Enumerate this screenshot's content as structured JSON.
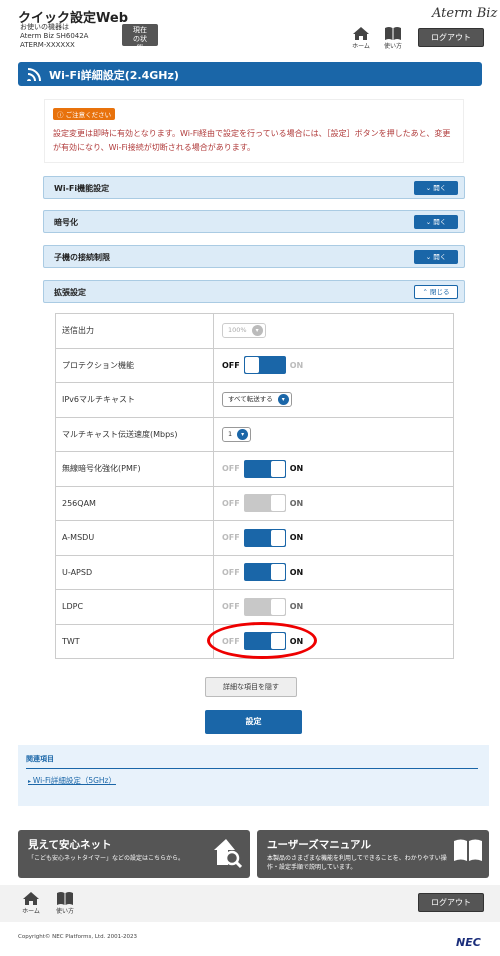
{
  "header": {
    "app_title": "クイック設定Web",
    "device_lines": [
      "お使いの機器は",
      "Aterm Biz SH6042A",
      "ATERM-XXXXXX"
    ],
    "status_button": "現在の状態",
    "brand": "Aterm Biz",
    "home_label": "ホーム",
    "help_label": "使い方",
    "logout_label": "ログアウト"
  },
  "page": {
    "title": "Wi-Fi詳細設定(2.4GHz)"
  },
  "notice": {
    "badge": "ご注意ください",
    "text": "設定変更は即時に有効となります。Wi-Fi経由で設定を行っている場合には、［設定］ボタンを押したあと、変更が有効になり、Wi-Fi接続が切断される場合があります。"
  },
  "sections": [
    {
      "label": "Wi-Fi機能設定",
      "button": "開く"
    },
    {
      "label": "暗号化",
      "button": "開く"
    },
    {
      "label": "子機の接続制限",
      "button": "開く"
    },
    {
      "label": "拡張設定",
      "button": "閉じる"
    }
  ],
  "settings": {
    "tx_power": {
      "label": "送信出力",
      "value": "100%"
    },
    "protection": {
      "label": "プロテクション機能",
      "off": "OFF",
      "on": "ON",
      "state": "off"
    },
    "ipv6_multicast": {
      "label": "IPv6マルチキャスト",
      "value": "すべて転送する"
    },
    "multicast_rate": {
      "label": "マルチキャスト伝送速度(Mbps)",
      "value": "1"
    },
    "pmf": {
      "label": "無線暗号化強化(PMF)",
      "off": "OFF",
      "on": "ON",
      "state": "on"
    },
    "qam256": {
      "label": "256QAM",
      "off": "OFF",
      "on": "ON",
      "state": "on",
      "disabled": true
    },
    "amsdu": {
      "label": "A-MSDU",
      "off": "OFF",
      "on": "ON",
      "state": "on"
    },
    "uapsd": {
      "label": "U-APSD",
      "off": "OFF",
      "on": "ON",
      "state": "on"
    },
    "ldpc": {
      "label": "LDPC",
      "off": "OFF",
      "on": "ON",
      "state": "on",
      "disabled": true
    },
    "twt": {
      "label": "TWT",
      "off": "OFF",
      "on": "ON",
      "state": "on"
    }
  },
  "buttons": {
    "hide_details": "詳細な項目を隠す",
    "apply": "設定"
  },
  "related": {
    "heading": "関連項目",
    "link": "Wi-Fi詳細設定（5GHz）"
  },
  "banners": {
    "safe_net": {
      "title": "見えて安心ネット",
      "desc": "「こども安心ネットタイマー」などの設定はこちらから。"
    },
    "manual": {
      "title": "ユーザーズマニュアル",
      "desc": "本製品のさまざまな機能を利用してできることを、わかりやすい操作・設定手順で説明しています。"
    }
  },
  "footer": {
    "home_label": "ホーム",
    "help_label": "使い方",
    "logout_label": "ログアウト",
    "copyright": "Copyright© NEC Platforms, Ltd. 2001-2023",
    "logo": "NEC"
  },
  "colors": {
    "primary": "#1a66a8",
    "notice_badge": "#e8720c",
    "highlight_ring": "#e00000"
  }
}
